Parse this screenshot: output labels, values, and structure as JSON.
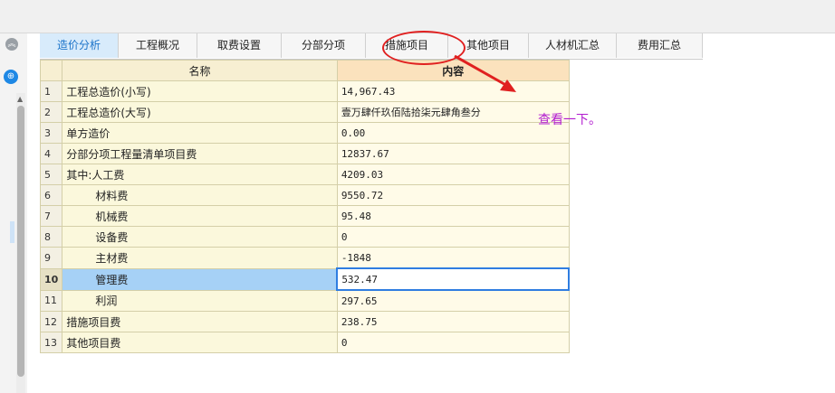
{
  "tabs": [
    "造价分析",
    "工程概况",
    "取费设置",
    "分部分项",
    "措施项目",
    "其他项目",
    "人材机汇总",
    "费用汇总"
  ],
  "header": {
    "name": "名称",
    "content": "内容"
  },
  "rows": [
    {
      "num": "1",
      "name": "工程总造价(小写)",
      "value": "14,967.43"
    },
    {
      "num": "2",
      "name": "工程总造价(大写)",
      "value": "壹万肆仟玖佰陆拾柒元肆角叁分"
    },
    {
      "num": "3",
      "name": "单方造价",
      "value": "0.00"
    },
    {
      "num": "4",
      "name": "分部分项工程量清单项目费",
      "value": "12837.67"
    },
    {
      "num": "5",
      "name": "其中:人工费",
      "value": "4209.03"
    },
    {
      "num": "6",
      "name": "材料费",
      "value": "9550.72"
    },
    {
      "num": "7",
      "name": "机械费",
      "value": "95.48"
    },
    {
      "num": "8",
      "name": "设备费",
      "value": "0"
    },
    {
      "num": "9",
      "name": "主材费",
      "value": "-1848"
    },
    {
      "num": "10",
      "name": "管理费",
      "value": "532.47"
    },
    {
      "num": "11",
      "name": "利润",
      "value": "297.65"
    },
    {
      "num": "12",
      "name": "措施项目费",
      "value": "238.75"
    },
    {
      "num": "13",
      "name": "其他项目费",
      "value": "0"
    }
  ],
  "annotation": {
    "text": "查看一下。"
  },
  "colors": {
    "accent": "#1b73c9",
    "selection": "#a6d1f6",
    "annotation_red": "#e02020",
    "annotation_text": "#b21ccf"
  }
}
